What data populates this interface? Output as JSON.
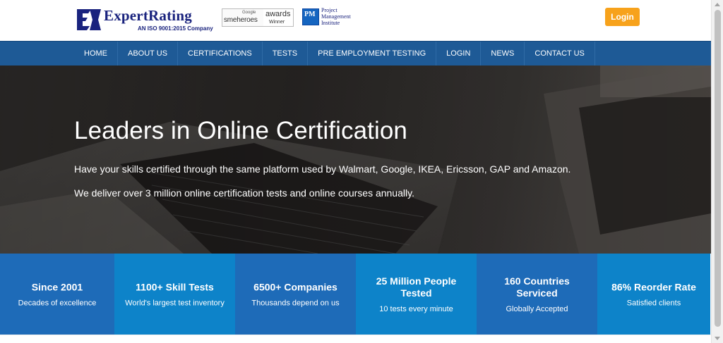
{
  "brand": {
    "name": "ExpertRating",
    "tagline": "AN ISO 9001:2015 Company",
    "primary_color": "#1a237e",
    "accent_color": "#f7a21b"
  },
  "awards": {
    "google_label": "Google",
    "smeheroes_label": "smeheroes",
    "awards_label": "awards",
    "winner_label": "Winner"
  },
  "pmi": {
    "line1": "Project",
    "line2": "Management",
    "line3": "Institute"
  },
  "header": {
    "login_label": "Login"
  },
  "nav": {
    "items": [
      {
        "label": "HOME"
      },
      {
        "label": "ABOUT US"
      },
      {
        "label": "CERTIFICATIONS"
      },
      {
        "label": "TESTS"
      },
      {
        "label": "PRE EMPLOYMENT TESTING"
      },
      {
        "label": "LOGIN"
      },
      {
        "label": "NEWS"
      },
      {
        "label": "CONTACT US"
      }
    ],
    "background": "#1e5a96"
  },
  "hero": {
    "heading": "Leaders in Online Certification",
    "line1": "Have your skills certified through the same platform used by Walmart, Google, IKEA, Ericsson, GAP and Amazon.",
    "line2": "We deliver over 3 million online certification tests and online courses annually."
  },
  "stats": [
    {
      "title": "Since 2001",
      "sub": "Decades of excellence"
    },
    {
      "title": "1100+ Skill Tests",
      "sub": "World's largest test inventory"
    },
    {
      "title": "6500+ Companies",
      "sub": "Thousands depend on us"
    },
    {
      "title": "25 Million People Tested",
      "sub": "10 tests every minute"
    },
    {
      "title": "160 Countries Serviced",
      "sub": "Globally Accepted"
    },
    {
      "title": "86% Reorder Rate",
      "sub": "Satisfied clients"
    }
  ]
}
